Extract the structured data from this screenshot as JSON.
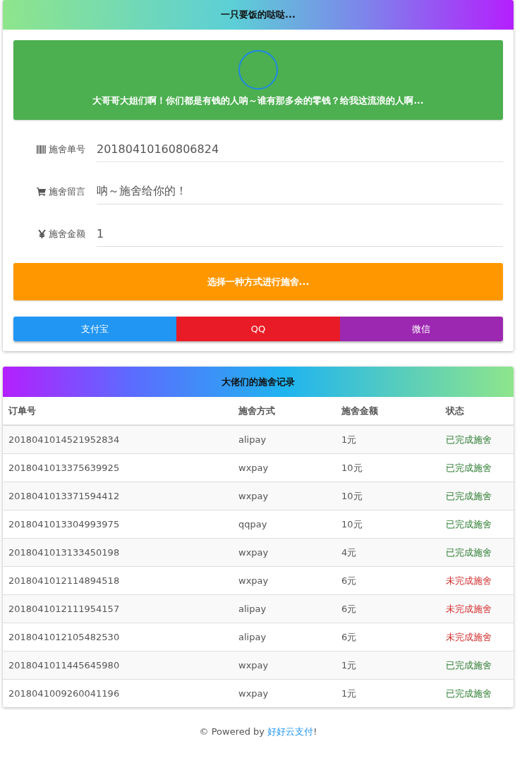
{
  "donate_card": {
    "title": "一只要饭的哒哒...",
    "banner": {
      "message": "大哥哥大姐们啊！你们都是有钱的人呐～谁有那多余的零钱？给我这流浪的人啊..."
    },
    "fields": [
      {
        "kind": "barcode",
        "label": "施舍单号",
        "value": "20180410160806824",
        "readonly": true
      },
      {
        "kind": "cart",
        "label": "施舍留言",
        "value": "呐～施舍给你的！",
        "readonly": false
      },
      {
        "kind": "yen",
        "label": "施舍金额",
        "value": "1",
        "readonly": false
      }
    ],
    "prompt": "选择一种方式进行施舍...",
    "payment_buttons": [
      {
        "label": "支付宝",
        "color": "#2196f3"
      },
      {
        "label": "QQ",
        "color": "#e91b26"
      },
      {
        "label": "微信",
        "color": "#9c27b0"
      }
    ]
  },
  "records_card": {
    "title": "大佬们的施舍记录",
    "table": {
      "columns": [
        "订单号",
        "施舍方式",
        "施舍金额",
        "状态"
      ],
      "rows": [
        {
          "order": "2018041014521952834",
          "method": "alipay",
          "amount": "1元",
          "status": "已完成施舍",
          "completed": true
        },
        {
          "order": "2018041013375639925",
          "method": "wxpay",
          "amount": "10元",
          "status": "已完成施舍",
          "completed": true
        },
        {
          "order": "2018041013371594412",
          "method": "wxpay",
          "amount": "10元",
          "status": "已完成施舍",
          "completed": true
        },
        {
          "order": "2018041013304993975",
          "method": "qqpay",
          "amount": "10元",
          "status": "已完成施舍",
          "completed": true
        },
        {
          "order": "2018041013133450198",
          "method": "wxpay",
          "amount": "4元",
          "status": "已完成施舍",
          "completed": true
        },
        {
          "order": "2018041012114894518",
          "method": "wxpay",
          "amount": "6元",
          "status": "未完成施舍",
          "completed": false
        },
        {
          "order": "2018041012111954157",
          "method": "alipay",
          "amount": "6元",
          "status": "未完成施舍",
          "completed": false
        },
        {
          "order": "2018041012105482530",
          "method": "alipay",
          "amount": "6元",
          "status": "未完成施舍",
          "completed": false
        },
        {
          "order": "2018041011445645980",
          "method": "wxpay",
          "amount": "1元",
          "status": "已完成施舍",
          "completed": true
        },
        {
          "order": "2018041009260041196",
          "method": "wxpay",
          "amount": "1元",
          "status": "已完成施舍",
          "completed": true
        }
      ]
    }
  },
  "footer": {
    "prefix": "© Powered by ",
    "link": "好好云支付",
    "suffix": "!"
  }
}
